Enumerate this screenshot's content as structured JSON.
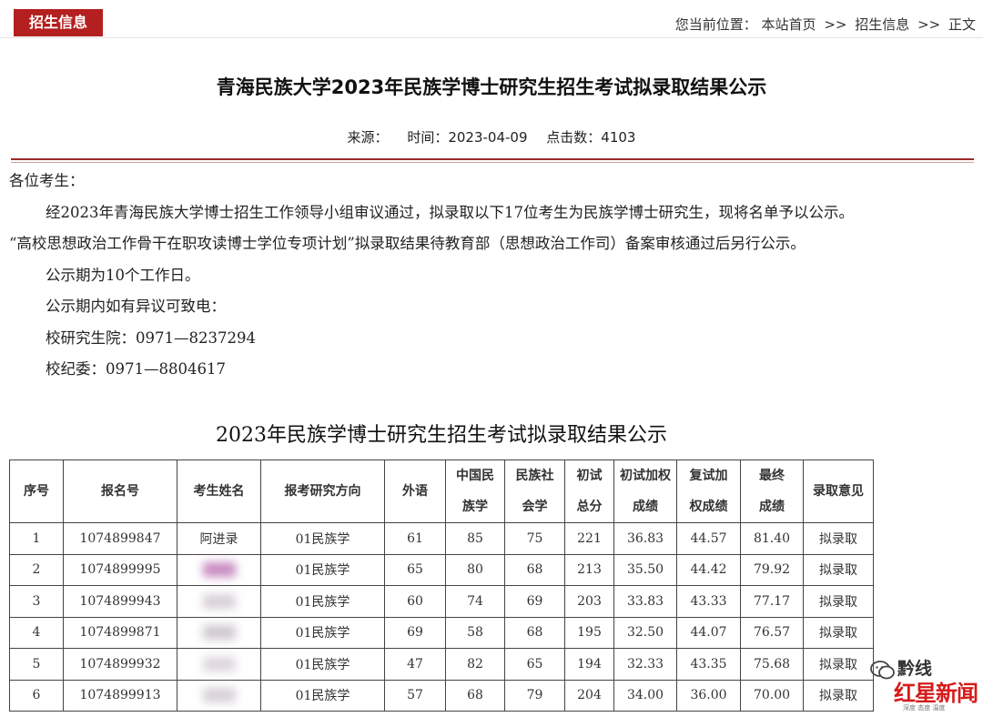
{
  "header": {
    "section_tab": "招生信息",
    "breadcrumb": {
      "prefix": "您当前位置：",
      "home": "本站首页",
      "sep1": ">>",
      "section": "招生信息",
      "sep2": ">>",
      "current": "正文"
    }
  },
  "article": {
    "title": "青海民族大学2023年民族学博士研究生招生考试拟录取结果公示",
    "meta": {
      "source_label": "来源：",
      "time_label": "时间：2023-04-09",
      "clicks_label": "点击数：4103"
    },
    "paragraphs": [
      "各位考生：",
      "经2023年青海民族大学博士招生工作领导小组审议通过，拟录取以下17位考生为民族学博士研究生，现将名单予以公示。",
      "“高校思想政治工作骨干在职攻读博士学位专项计划”拟录取结果待教育部（思想政治工作司）备案审核通过后另行公示。",
      "公示期为10个工作日。",
      "公示期内如有异议可致电：",
      "校研究生院：0971—8237294",
      "校纪委：0971—8804617"
    ]
  },
  "table": {
    "title": "2023年民族学博士研究生招生考试拟录取结果公示",
    "headers": [
      [
        "序号"
      ],
      [
        "报名号"
      ],
      [
        "考生姓名"
      ],
      [
        "报考研究方向"
      ],
      [
        "外语"
      ],
      [
        "中国民",
        "族学"
      ],
      [
        "民族社",
        "会学"
      ],
      [
        "初试",
        "总分"
      ],
      [
        "初试加权",
        "成绩"
      ],
      [
        "复试加",
        "权成绩"
      ],
      [
        "最终",
        "成绩"
      ],
      [
        "录取意见"
      ]
    ],
    "rows": [
      [
        "1",
        "1074899847",
        "阿进录",
        "01民族学",
        "61",
        "85",
        "75",
        "221",
        "36.83",
        "44.57",
        "81.40",
        "拟录取"
      ],
      [
        "2",
        "1074899995",
        "",
        "01民族学",
        "65",
        "80",
        "68",
        "213",
        "35.50",
        "44.42",
        "79.92",
        "拟录取"
      ],
      [
        "3",
        "1074899943",
        "",
        "01民族学",
        "60",
        "74",
        "69",
        "203",
        "33.83",
        "43.33",
        "77.17",
        "拟录取"
      ],
      [
        "4",
        "1074899871",
        "",
        "01民族学",
        "69",
        "58",
        "68",
        "195",
        "32.50",
        "44.07",
        "76.57",
        "拟录取"
      ],
      [
        "5",
        "1074899932",
        "",
        "01民族学",
        "47",
        "82",
        "65",
        "194",
        "32.33",
        "43.35",
        "75.68",
        "拟录取"
      ],
      [
        "6",
        "1074899913",
        "",
        "01民族学",
        "57",
        "68",
        "79",
        "204",
        "34.00",
        "36.00",
        "70.00",
        "拟录取"
      ]
    ]
  },
  "watermark": {
    "account": "黔线",
    "brand": "红星新闻",
    "tagline": "深度 态度 温度"
  },
  "colors": {
    "accent": "#b41f1f",
    "rule": "#9a2a2a",
    "brand_red": "#d61a1a"
  }
}
